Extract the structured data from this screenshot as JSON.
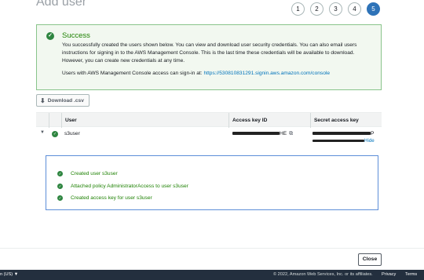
{
  "page": {
    "heading": "Add user"
  },
  "steps": [
    "1",
    "2",
    "3",
    "4",
    "5"
  ],
  "success": {
    "title": "Success",
    "body": "You successfully created the users shown below. You can view and download user security credentials. You can also email users instructions for signing in to the AWS Management Console. This is the last time these credentials will be available to download. However, you can create new credentials at any time.",
    "signin_prefix": "Users with AWS Management Console access can sign-in at:",
    "signin_url": "https://530810831291.signin.aws.amazon.com/console"
  },
  "download_button": {
    "label": "Download .csv"
  },
  "table": {
    "headers": {
      "user": "User",
      "access_key_id": "Access key ID",
      "secret_access_key": "Secret access key"
    },
    "row": {
      "user": "s3user",
      "access_key_suffix": "HE",
      "secret_suffix": "P",
      "hide_label": "Hide"
    }
  },
  "details": [
    "Created user s3user",
    "Attached policy AdministratorAccess to user s3user",
    "Created access key for user s3user"
  ],
  "close_button": {
    "label": "Close"
  },
  "footer": {
    "language": "n (US) ▼",
    "copyright": "© 2022, Amazon Web Services, Inc. or its affiliates.",
    "privacy": "Privacy",
    "terms": "Terms"
  },
  "icons": {
    "success": "check-circle-icon",
    "download": "download-icon",
    "expand": "caret-down-icon",
    "copy": "copy-icon"
  },
  "colors": {
    "accent": "#2e73b8",
    "success": "#1d8102",
    "link": "#0073bb",
    "footer_bg": "#232f3e"
  }
}
